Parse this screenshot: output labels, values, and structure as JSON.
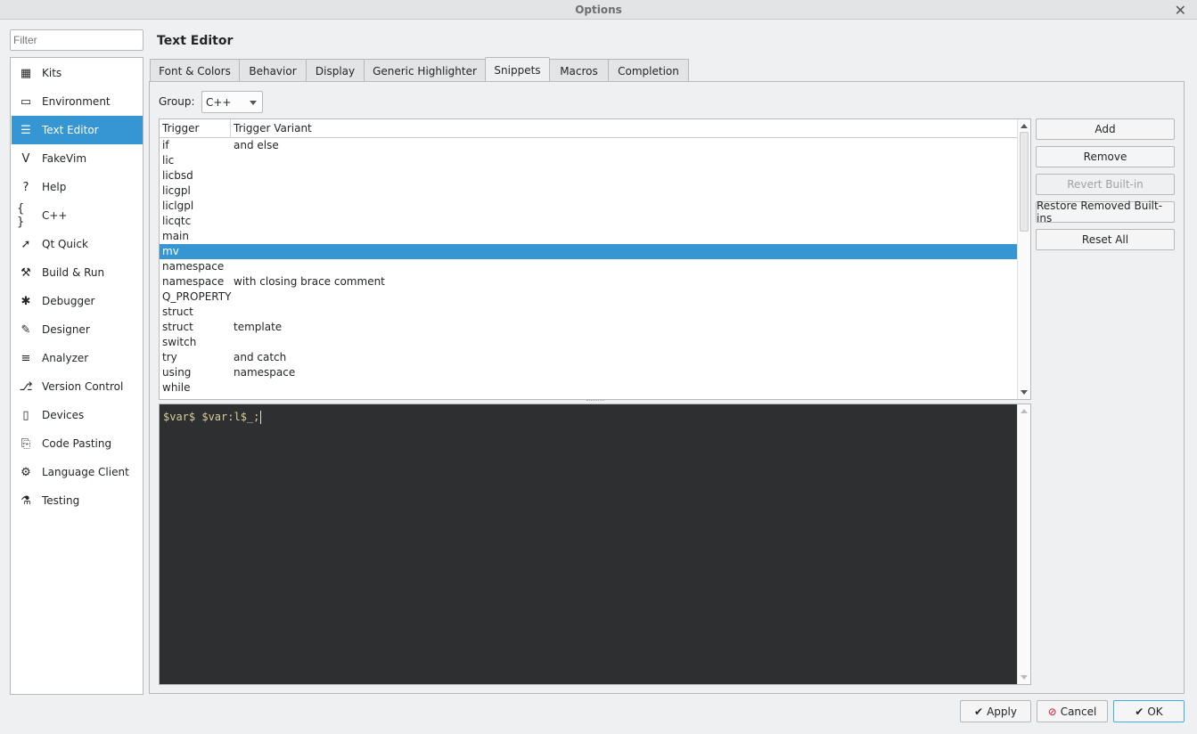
{
  "window": {
    "title": "Options",
    "close_glyph": "✕"
  },
  "filter": {
    "placeholder": "Filter"
  },
  "sidebar": {
    "items": [
      {
        "label": "Kits",
        "icon": "kits-icon",
        "glyph": "▦"
      },
      {
        "label": "Environment",
        "icon": "monitor-icon",
        "glyph": "▭"
      },
      {
        "label": "Text Editor",
        "icon": "text-editor-icon",
        "glyph": "☰",
        "selected": true
      },
      {
        "label": "FakeVim",
        "icon": "fakevim-icon",
        "glyph": "V"
      },
      {
        "label": "Help",
        "icon": "help-icon",
        "glyph": "?"
      },
      {
        "label": "C++",
        "icon": "braces-icon",
        "glyph": "{ }"
      },
      {
        "label": "Qt Quick",
        "icon": "qtquick-icon",
        "glyph": "➚"
      },
      {
        "label": "Build & Run",
        "icon": "hammer-icon",
        "glyph": "⚒"
      },
      {
        "label": "Debugger",
        "icon": "bug-icon",
        "glyph": "✱"
      },
      {
        "label": "Designer",
        "icon": "pen-icon",
        "glyph": "✎"
      },
      {
        "label": "Analyzer",
        "icon": "analyzer-icon",
        "glyph": "≡"
      },
      {
        "label": "Version Control",
        "icon": "version-control-icon",
        "glyph": "⎇"
      },
      {
        "label": "Devices",
        "icon": "devices-icon",
        "glyph": "▯"
      },
      {
        "label": "Code Pasting",
        "icon": "paste-icon",
        "glyph": "⎘"
      },
      {
        "label": "Language Client",
        "icon": "language-client-icon",
        "glyph": "⚙"
      },
      {
        "label": "Testing",
        "icon": "testing-icon",
        "glyph": "⚗"
      }
    ]
  },
  "page_title": "Text Editor",
  "tabs": [
    {
      "label": "Font & Colors"
    },
    {
      "label": "Behavior"
    },
    {
      "label": "Display"
    },
    {
      "label": "Generic Highlighter"
    },
    {
      "label": "Snippets",
      "active": true
    },
    {
      "label": "Macros"
    },
    {
      "label": "Completion"
    }
  ],
  "group": {
    "label": "Group:",
    "value": "C++"
  },
  "snippets": {
    "headers": [
      "Trigger",
      "Trigger Variant"
    ],
    "rows": [
      {
        "trigger": "if",
        "variant": "and else"
      },
      {
        "trigger": "lic",
        "variant": ""
      },
      {
        "trigger": "licbsd",
        "variant": ""
      },
      {
        "trigger": "licgpl",
        "variant": ""
      },
      {
        "trigger": "liclgpl",
        "variant": ""
      },
      {
        "trigger": "licqtc",
        "variant": ""
      },
      {
        "trigger": "main",
        "variant": ""
      },
      {
        "trigger": "mv",
        "variant": "",
        "selected": true
      },
      {
        "trigger": "namespace",
        "variant": ""
      },
      {
        "trigger": "namespace",
        "variant": "with closing brace comment"
      },
      {
        "trigger": "Q_PROPERTY",
        "variant": ""
      },
      {
        "trigger": "struct",
        "variant": ""
      },
      {
        "trigger": "struct",
        "variant": "template"
      },
      {
        "trigger": "switch",
        "variant": ""
      },
      {
        "trigger": "try",
        "variant": "and catch"
      },
      {
        "trigger": "using",
        "variant": "namespace"
      },
      {
        "trigger": "while",
        "variant": ""
      }
    ]
  },
  "editor": {
    "code": "$var$ $var:l$_;"
  },
  "actions": {
    "add": "Add",
    "remove": "Remove",
    "revert": "Revert Built-in",
    "restore": "Restore Removed Built-ins",
    "reset": "Reset All"
  },
  "footer": {
    "apply": "Apply",
    "cancel": "Cancel",
    "ok": "OK",
    "apply_glyph": "✔",
    "cancel_glyph": "⊘",
    "ok_glyph": "✔"
  },
  "colors": {
    "selection": "#3596d3",
    "editor_bg": "#2e2f30",
    "editor_text": "#d6cf9a",
    "cancel_icon": "#da4453"
  }
}
